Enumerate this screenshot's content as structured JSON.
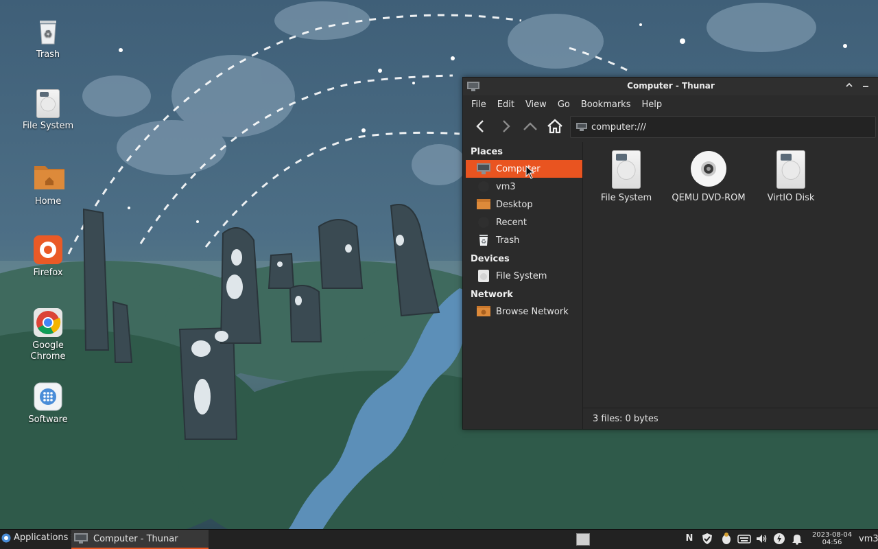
{
  "desktop": {
    "icons": [
      {
        "label": "Trash"
      },
      {
        "label": "File System"
      },
      {
        "label": "Home"
      },
      {
        "label": "Firefox"
      },
      {
        "label": "Google\nChrome"
      },
      {
        "label": "Software"
      }
    ]
  },
  "window": {
    "title": "Computer - Thunar",
    "menu": [
      "File",
      "Edit",
      "View",
      "Go",
      "Bookmarks",
      "Help"
    ],
    "location": "computer:///",
    "sidebar": {
      "places_header": "Places",
      "places": [
        "Computer",
        "vm3",
        "Desktop",
        "Recent",
        "Trash"
      ],
      "devices_header": "Devices",
      "devices": [
        "File System"
      ],
      "network_header": "Network",
      "network": [
        "Browse Network"
      ],
      "selected": "Computer"
    },
    "files": [
      "File System",
      "QEMU DVD-ROM",
      "VirtIO Disk"
    ],
    "status": "3 files: 0 bytes"
  },
  "taskbar": {
    "applications_label": "Applications",
    "task_label": "Computer - Thunar",
    "clock_date": "2023-08-04",
    "clock_time": "04:56",
    "user": "vm3"
  },
  "colors": {
    "accent": "#e95420",
    "window_bg": "#2b2b2b",
    "taskbar_bg": "#222222"
  }
}
